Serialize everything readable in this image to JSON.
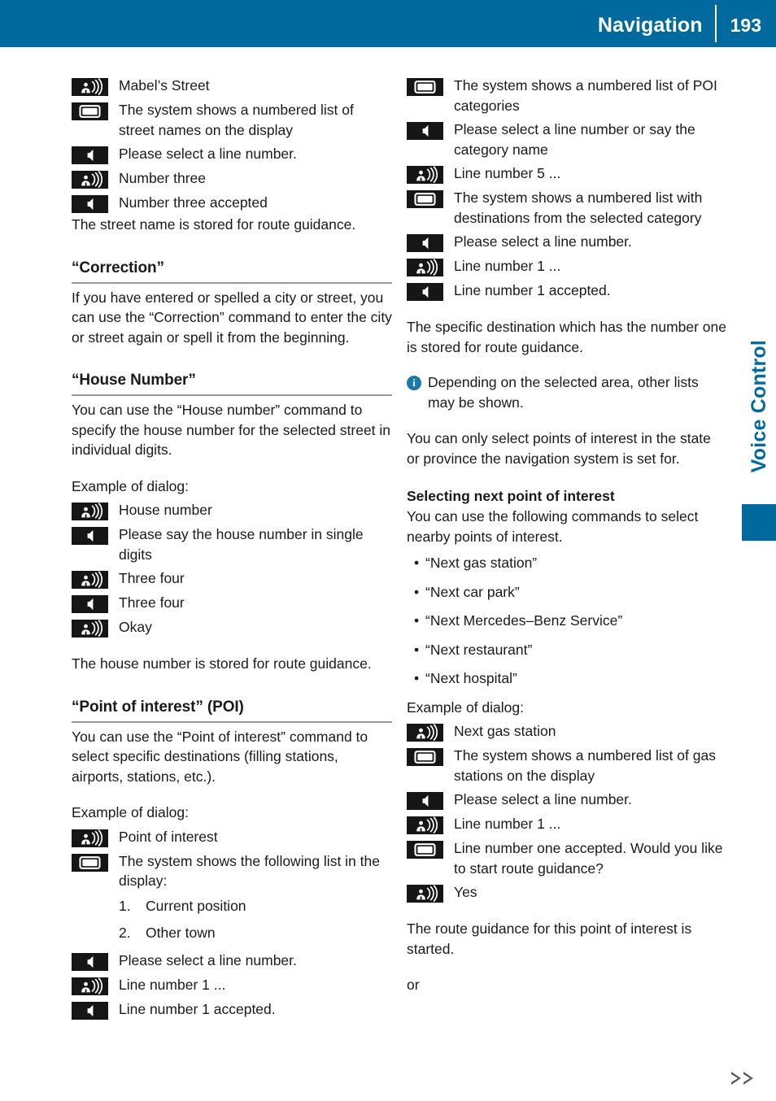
{
  "header": {
    "title": "Navigation",
    "page_number": "193"
  },
  "side_tab": {
    "label": "Voice Control"
  },
  "icons": {
    "user_speaks": "user-speaking-icon",
    "display": "display-screen-icon",
    "system_speaks": "loudspeaker-icon",
    "info": "info-icon",
    "continuation": "continuation-arrows-icon"
  },
  "left_column": {
    "dialog_street": [
      {
        "icon": "user_speaks",
        "text": "Mabel’s Street"
      },
      {
        "icon": "display",
        "text": "The system shows a numbered list of street names on the display"
      },
      {
        "icon": "system_speaks",
        "text": "Please select a line number."
      },
      {
        "icon": "user_speaks",
        "text": "Number three"
      },
      {
        "icon": "system_speaks",
        "text": "Number three accepted"
      }
    ],
    "street_stored_note": "The street name is stored for route guidance.",
    "correction": {
      "heading": "“Correction”",
      "body": "If you have entered or spelled a city or street, you can use the “Correction” command to enter the city or street again or spell it from the beginning."
    },
    "house_number": {
      "heading": "“House Number”",
      "body": "You can use the “House number” command to specify the house number for the selected street in individual digits.",
      "example_label": "Example of dialog:",
      "dialog": [
        {
          "icon": "user_speaks",
          "text": "House number"
        },
        {
          "icon": "system_speaks",
          "text": "Please say the house number in single digits"
        },
        {
          "icon": "user_speaks",
          "text": "Three four"
        },
        {
          "icon": "system_speaks",
          "text": "Three four"
        },
        {
          "icon": "user_speaks",
          "text": "Okay"
        }
      ],
      "stored_note": "The house number is stored for route guidance."
    },
    "poi": {
      "heading": "“Point of interest” (POI)",
      "body": "You can use the “Point of interest” command to select specific destinations (filling stations, airports, stations, etc.).",
      "example_label": "Example of dialog:",
      "dialog_before_list": [
        {
          "icon": "user_speaks",
          "text": "Point of interest"
        },
        {
          "icon": "display",
          "text": "The system shows the following list in the display:"
        }
      ],
      "numbered_list": [
        {
          "num": "1.",
          "text": "Current position"
        },
        {
          "num": "2.",
          "text": "Other town"
        }
      ],
      "dialog_after_list": [
        {
          "icon": "system_speaks",
          "text": "Please select a line number."
        },
        {
          "icon": "user_speaks",
          "text": "Line number 1 ..."
        },
        {
          "icon": "system_speaks",
          "text": "Line number 1 accepted."
        }
      ]
    }
  },
  "right_column": {
    "poi_continued": [
      {
        "icon": "display",
        "text": "The system shows a numbered list of POI categories"
      },
      {
        "icon": "system_speaks",
        "text": "Please select a line number or say the category name"
      },
      {
        "icon": "user_speaks",
        "text": "Line number 5 ..."
      },
      {
        "icon": "display",
        "text": "The system shows a numbered list with destinations from the selected category"
      },
      {
        "icon": "system_speaks",
        "text": "Please select a line number."
      },
      {
        "icon": "user_speaks",
        "text": "Line number 1 ..."
      },
      {
        "icon": "system_speaks",
        "text": "Line number 1 accepted."
      }
    ],
    "destination_stored_note": "The specific destination which has the number one is stored for route guidance.",
    "info_note": "Depending on the selected area, other lists may be shown.",
    "state_note": "You can only select points of interest in the state or province the navigation system is set for.",
    "next_poi": {
      "heading": "Selecting next point of interest",
      "body": "You can use the following commands to select nearby points of interest.",
      "commands": [
        "“Next gas station”",
        "“Next car park”",
        "“Next Mercedes–Benz Service”",
        "“Next restaurant”",
        "“Next hospital”"
      ],
      "example_label": "Example of dialog:",
      "dialog": [
        {
          "icon": "user_speaks",
          "text": "Next gas station"
        },
        {
          "icon": "display",
          "text": "The system shows a numbered list of gas stations on the display"
        },
        {
          "icon": "system_speaks",
          "text": "Please select a line number."
        },
        {
          "icon": "user_speaks",
          "text": "Line number 1 ..."
        },
        {
          "icon": "display",
          "text": "Line number one accepted. Would you like to start route guidance?"
        },
        {
          "icon": "user_speaks",
          "text": "Yes"
        }
      ],
      "started_note": "The route guidance for this point of interest is started.",
      "or_label": "or"
    }
  },
  "colors": {
    "brand_blue": "#00699e",
    "info_blue": "#1a7aa8",
    "rule_gray": "#999999",
    "icon_black": "#161616"
  }
}
